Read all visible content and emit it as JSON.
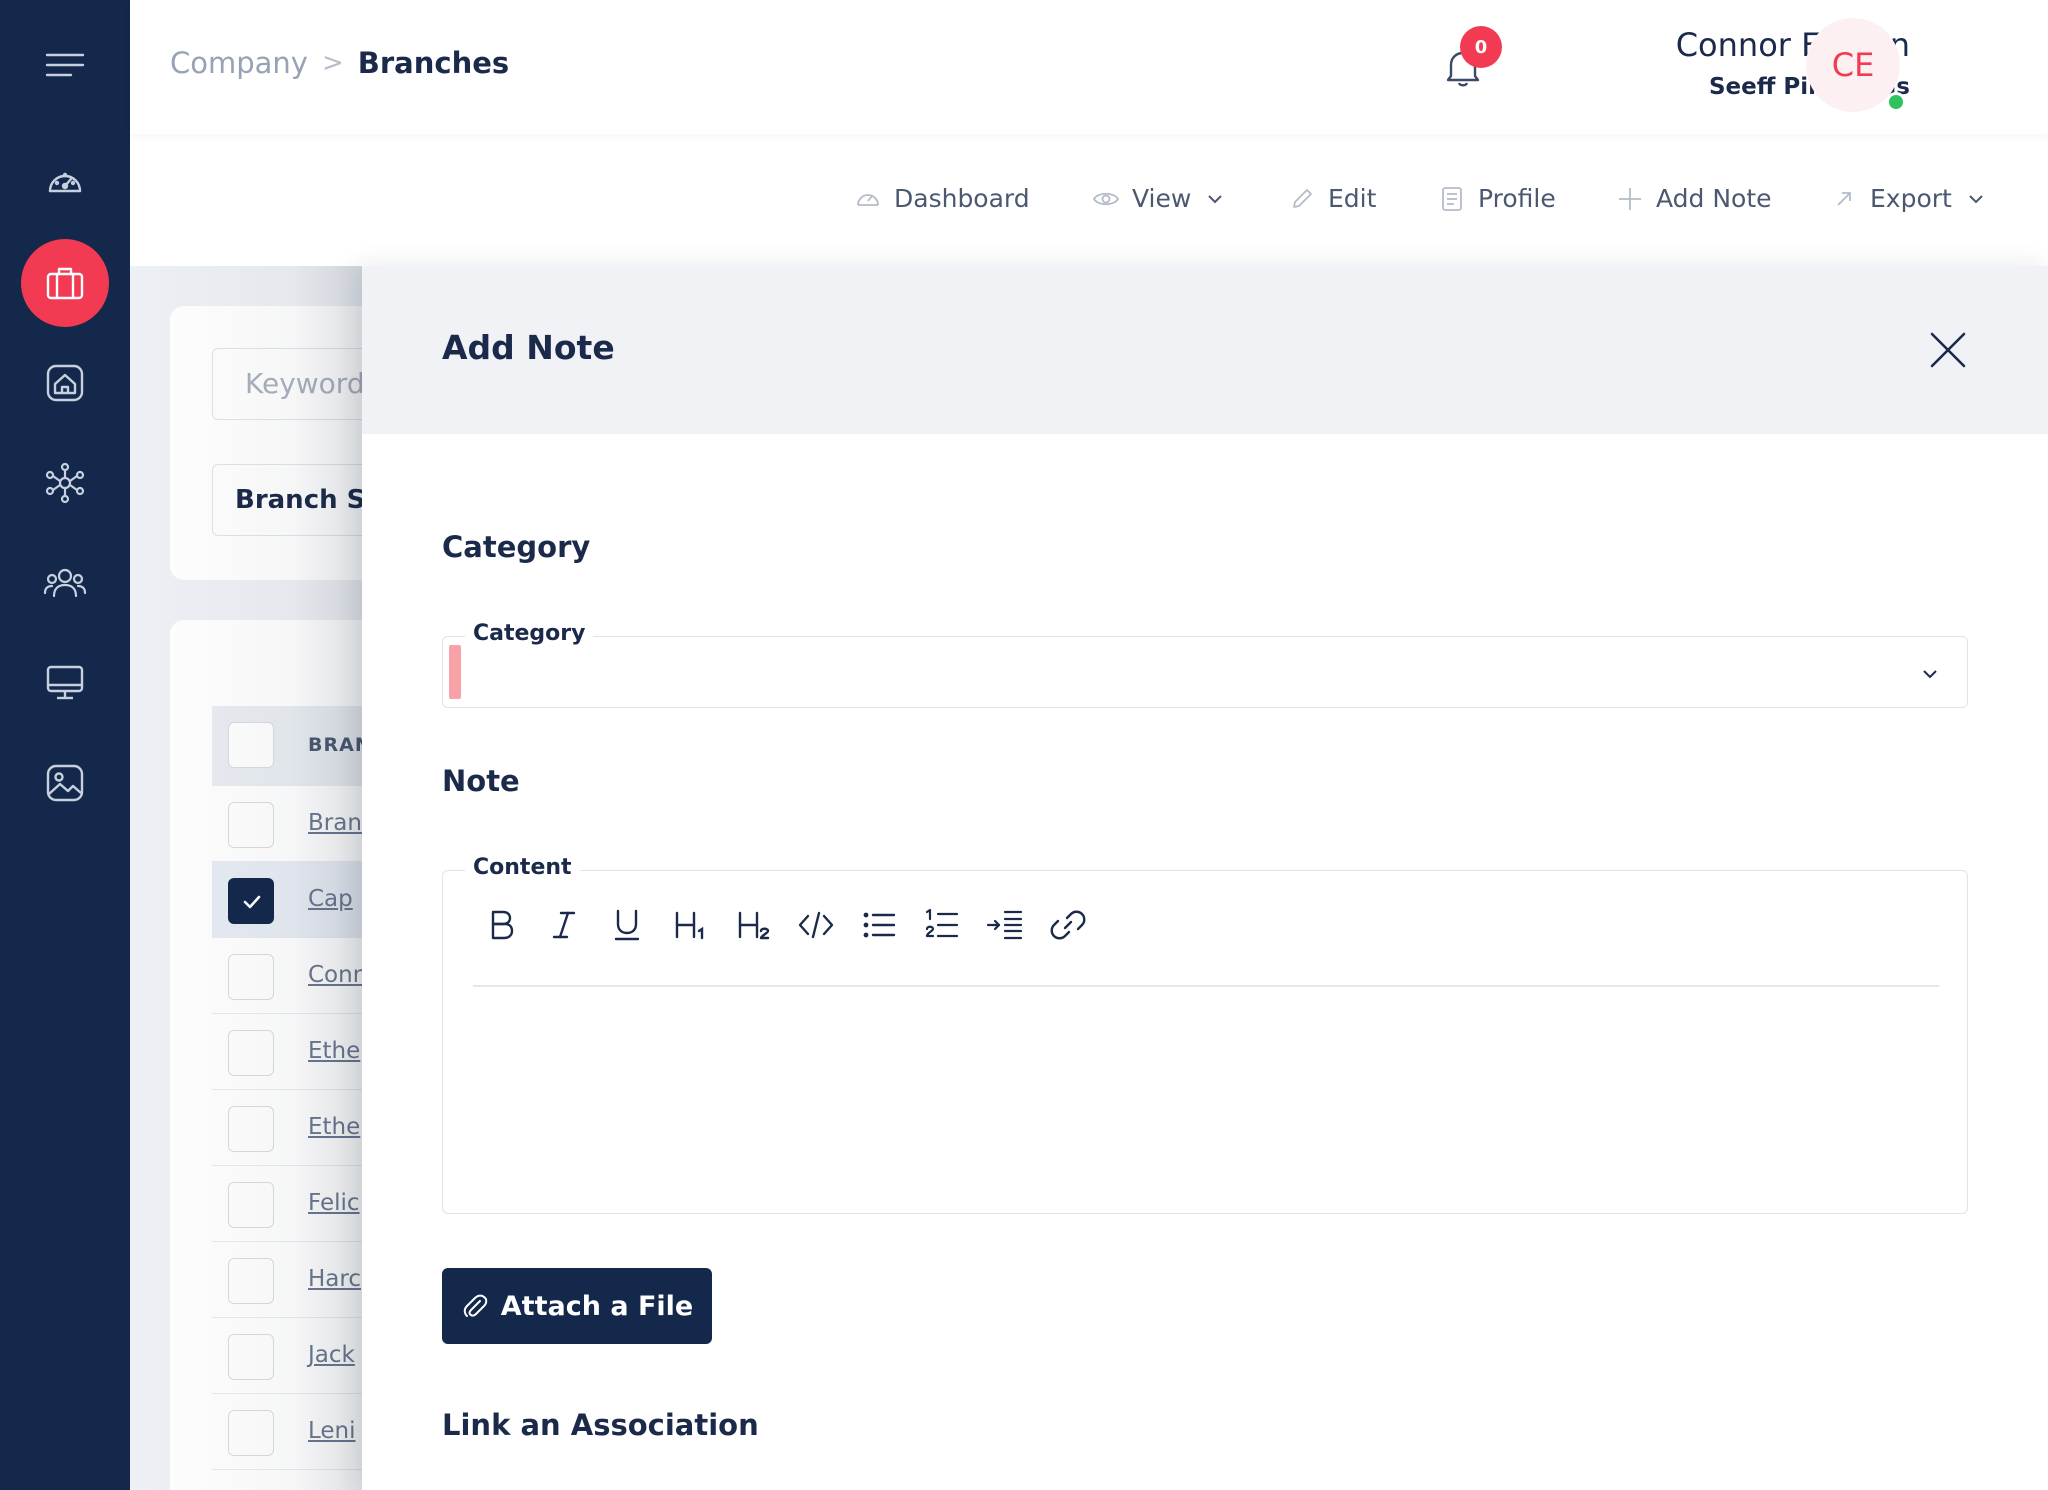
{
  "sidebar": {
    "items": [
      {
        "icon": "menu-icon"
      },
      {
        "icon": "dashboard-icon"
      },
      {
        "icon": "briefcase-icon",
        "active": true
      },
      {
        "icon": "home-icon"
      },
      {
        "icon": "network-icon"
      },
      {
        "icon": "users-icon"
      },
      {
        "icon": "monitor-icon"
      },
      {
        "icon": "image-icon"
      }
    ]
  },
  "header": {
    "breadcrumb": {
      "company": "Company",
      "separator": ">",
      "current": "Branches"
    },
    "notifications": {
      "count": "0"
    },
    "user": {
      "name": "Connor Easton",
      "branch": "Seeff Pinelands",
      "initials": "CE"
    }
  },
  "toolbar": {
    "dashboard": "Dashboard",
    "view": "View",
    "edit": "Edit",
    "profile": "Profile",
    "add_note": "Add Note",
    "export": "Export"
  },
  "list": {
    "keyword_placeholder": "Keyword",
    "status_select": "Branch St",
    "header_label": "BRAN",
    "rows": [
      {
        "label": "Bran",
        "checked": false
      },
      {
        "label": "Cap",
        "checked": true
      },
      {
        "label": "Conr",
        "checked": false
      },
      {
        "label": "Ethe",
        "checked": false
      },
      {
        "label": "Ethe",
        "checked": false
      },
      {
        "label": "Felic",
        "checked": false
      },
      {
        "label": "Harc",
        "checked": false
      },
      {
        "label": "Jack",
        "checked": false
      },
      {
        "label": "Leni",
        "checked": false
      }
    ]
  },
  "drawer": {
    "title": "Add Note",
    "category_section": "Category",
    "category_field_label": "Category",
    "note_section": "Note",
    "content_label": "Content",
    "attach_button": "Attach a File",
    "link_section": "Link an Association"
  },
  "colors": {
    "sidebar": "#13284b",
    "accent": "#f23b53",
    "primary_button": "#13284b",
    "online": "#2fc15e"
  }
}
